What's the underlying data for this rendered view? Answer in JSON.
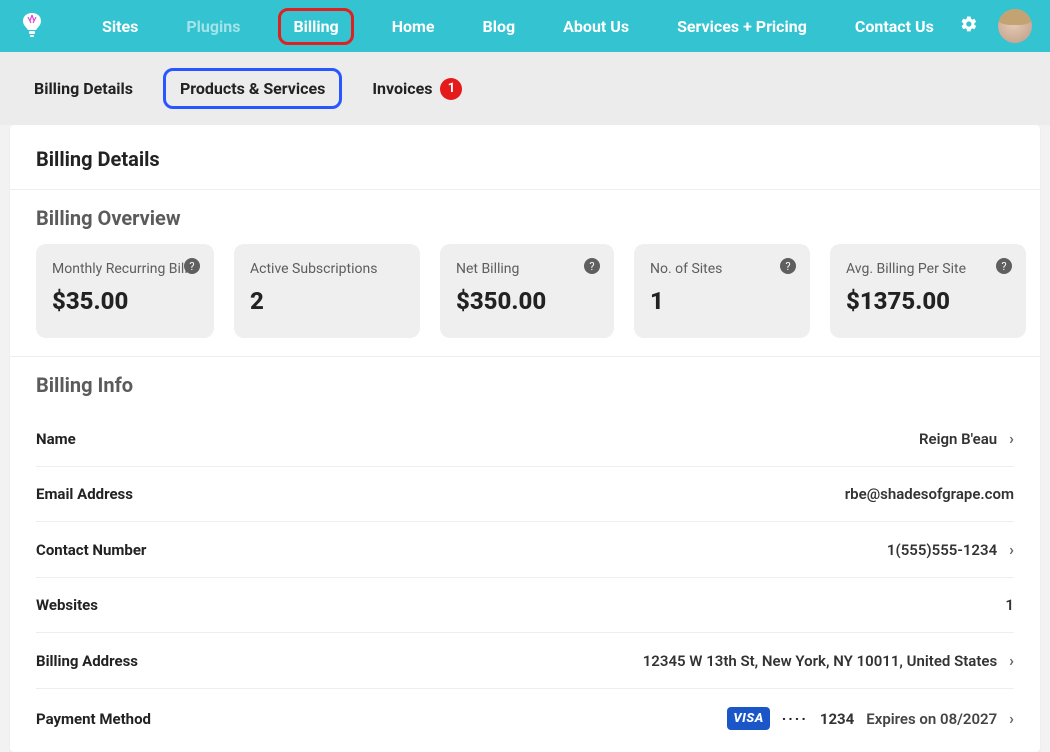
{
  "nav": {
    "sites": "Sites",
    "plugins": "Plugins",
    "billing": "Billing",
    "home": "Home",
    "blog": "Blog",
    "about": "About Us",
    "services_pricing": "Services  + Pricing",
    "contact": "Contact Us"
  },
  "tabs": {
    "billing_details": "Billing Details",
    "products_services": "Products & Services",
    "invoices": "Invoices",
    "invoices_badge": "1"
  },
  "page": {
    "title": "Billing Details",
    "overview_title": "Billing Overview",
    "info_title": "Billing Info"
  },
  "overview": {
    "monthly_label": "Monthly Recurring Bill",
    "monthly_value": "$35.00",
    "subs_label": "Active Subscriptions",
    "subs_value": "2",
    "net_label": "Net Billing",
    "net_value": "$350.00",
    "sites_label": "No. of Sites",
    "sites_value": "1",
    "avg_label": "Avg. Billing Per Site",
    "avg_value": "$1375.00",
    "help_glyph": "?"
  },
  "info": {
    "name_label": "Name",
    "name_value": "Reign B'eau",
    "email_label": "Email Address",
    "email_value": "rbe@shadesofgrape.com",
    "contact_label": "Contact Number",
    "contact_value": "1(555)555-1234",
    "websites_label": "Websites",
    "websites_value": "1",
    "address_label": "Billing Address",
    "address_value": "12345 W 13th St, New York, NY 10011, United States",
    "payment_label": "Payment Method",
    "card_brand": "VISA",
    "card_dots": "····",
    "card_last4": "1234",
    "card_expires": "Expires on  08/2027",
    "chevron": "›"
  }
}
